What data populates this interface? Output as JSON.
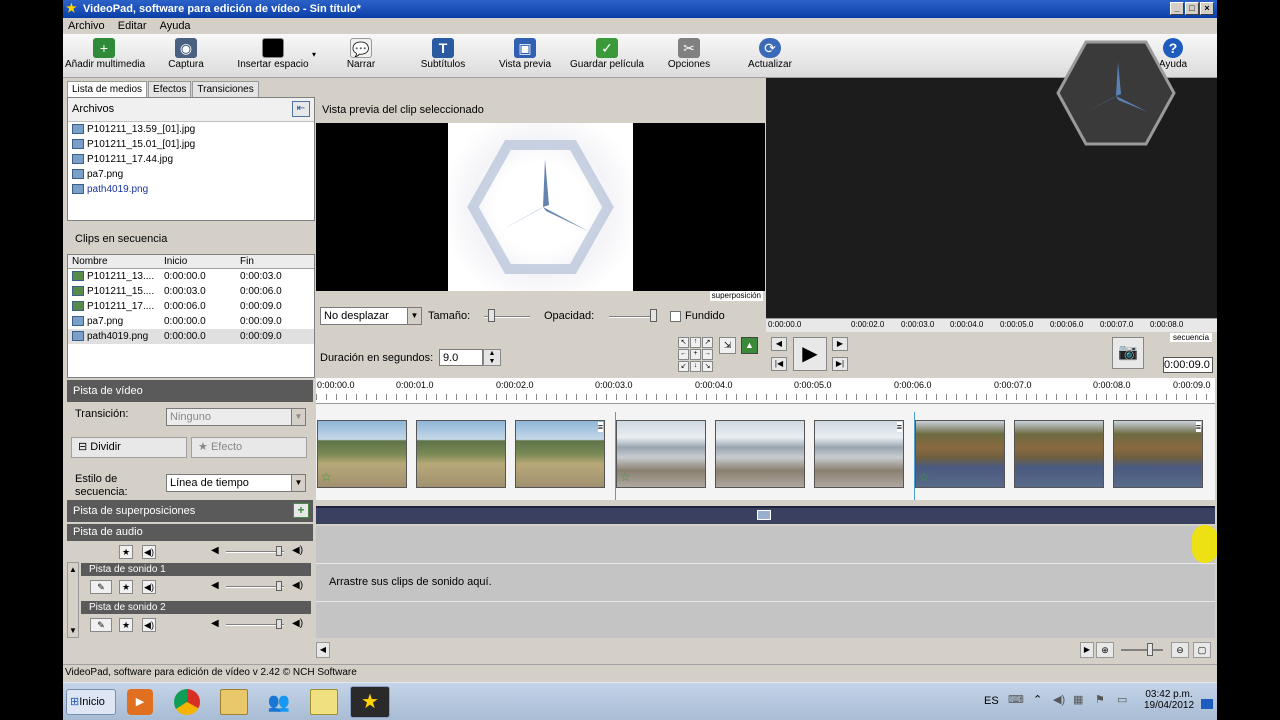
{
  "window": {
    "title": "VideoPad, software para edición de vídeo - Sin título*"
  },
  "menu": [
    "Archivo",
    "Editar",
    "Ayuda"
  ],
  "toolbar": [
    {
      "label": "Añadir multimedia",
      "icon": "add-media-icon",
      "color": "#2f8a3a"
    },
    {
      "label": "Captura",
      "icon": "capture-camera-icon",
      "color": "#4a6080"
    },
    {
      "label": "Insertar espacio",
      "icon": "insert-blank-icon",
      "color": "#000000"
    },
    {
      "label": "Narrar",
      "icon": "narrate-icon",
      "color": "#f0f0f0"
    },
    {
      "label": "Subtítulos",
      "icon": "subtitles-icon",
      "color": "#2a5aa0"
    },
    {
      "label": "Vista previa",
      "icon": "preview-icon",
      "color": "#3060b0"
    },
    {
      "label": "Guardar película",
      "icon": "save-movie-icon",
      "color": "#3a9a3a"
    },
    {
      "label": "Opciones",
      "icon": "options-icon",
      "color": "#808080"
    },
    {
      "label": "Actualizar",
      "icon": "update-icon",
      "color": "#3a6ab8"
    },
    {
      "label": "Ayuda",
      "icon": "help-icon",
      "color": "#1e5bbf"
    }
  ],
  "media": {
    "tabs": [
      "Lista de medios",
      "Efectos",
      "Transiciones"
    ],
    "header": "Archivos",
    "files": [
      "P101211_13.59_[01].jpg",
      "P101211_15.01_[01].jpg",
      "P101211_17.44.jpg",
      "pa7.png",
      "path4019.png"
    ]
  },
  "sequence": {
    "header": "Clips en secuencia",
    "columns": [
      "Nombre",
      "Inicio",
      "Fin"
    ],
    "rows": [
      [
        "P101211_13....",
        "0:00:00.0",
        "0:00:03.0"
      ],
      [
        "P101211_15....",
        "0:00:03.0",
        "0:00:06.0"
      ],
      [
        "P101211_17....",
        "0:00:06.0",
        "0:00:09.0"
      ],
      [
        "pa7.png",
        "0:00:00.0",
        "0:00:09.0"
      ],
      [
        "path4019.png",
        "0:00:00.0",
        "0:00:09.0"
      ]
    ]
  },
  "clip_preview": {
    "header": "Vista previa del clip seleccionado",
    "badge": "superposición",
    "pan": "No desplazar",
    "size_label": "Tamaño:",
    "opacity_label": "Opacidad:",
    "fade_label": "Fundido",
    "duration_label": "Duración en segundos:",
    "duration_value": "9.0"
  },
  "seq_preview": {
    "badge": "secuencia",
    "time": "0:00:09.0",
    "ticks": [
      "0:00:00.0",
      "0:00:02.0",
      "0:00:03.0",
      "0:00:04.0",
      "0:00:05.0",
      "0:00:06.0",
      "0:00:07.0",
      "0:00:08.0"
    ]
  },
  "video_track": {
    "header": "Pista de vídeo",
    "transition_label": "Transición:",
    "transition_value": "Ninguno",
    "split_label": "Dividir",
    "effect_label": "Efecto",
    "style_label": "Estilo de secuencia:",
    "style_value": "Línea de tiempo"
  },
  "timeline_ticks": [
    "0:00:00.0",
    "0:00:01.0",
    "0:00:02.0",
    "0:00:03.0",
    "0:00:04.0",
    "0:00:05.0",
    "0:00:06.0",
    "0:00:07.0",
    "0:00:08.0",
    "0:00:09.0"
  ],
  "overlay_track": {
    "header": "Pista de superposiciones"
  },
  "audio": {
    "header": "Pista de audio",
    "track1": "Pista de sonido 1",
    "track2": "Pista de sonido 2",
    "drop_hint": "Arrastre sus clips de sonido aquí."
  },
  "statusbar": "VideoPad, software para edición de vídeo v 2.42 © NCH Software",
  "taskbar": {
    "start": "Inicio",
    "lang": "ES",
    "time": "03:42 p.m.",
    "date": "19/04/2012"
  }
}
